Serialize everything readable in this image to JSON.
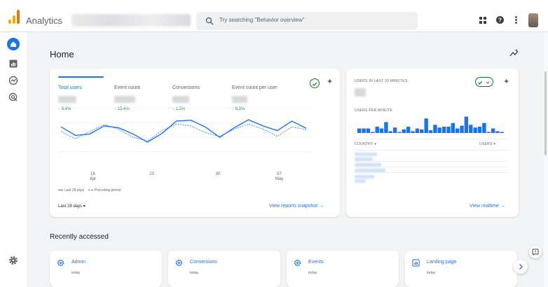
{
  "app": {
    "title": "Analytics"
  },
  "search": {
    "placeholder": "Try searching \"Behavior overview\""
  },
  "page": {
    "title": "Home"
  },
  "metrics": [
    {
      "label": "Total users",
      "delta": "↑ 9.4%",
      "active": true
    },
    {
      "label": "Event count",
      "delta": "↑ 15.4%",
      "active": false
    },
    {
      "label": "Conversions",
      "delta": "↑ 1.5%",
      "active": false
    },
    {
      "label": "Event count per user",
      "delta": "↑ 6.3%",
      "active": false
    }
  ],
  "chart": {
    "x_ticks": [
      {
        "day": "16",
        "month": "Apr"
      },
      {
        "day": "23",
        "month": ""
      },
      {
        "day": "30",
        "month": ""
      },
      {
        "day": "07",
        "month": "May"
      }
    ],
    "legend_current": "Last 28 days",
    "legend_previous": "Preceding period",
    "current": [
      0.6,
      0.42,
      0.45,
      0.62,
      0.58,
      0.45,
      0.28,
      0.46,
      0.72,
      0.74,
      0.6,
      0.38,
      0.58,
      0.75,
      0.62,
      0.52,
      0.72,
      0.57
    ],
    "previous": [
      0.5,
      0.35,
      0.5,
      0.65,
      0.55,
      0.38,
      0.3,
      0.52,
      0.66,
      0.62,
      0.48,
      0.4,
      0.55,
      0.66,
      0.55,
      0.4,
      0.6,
      0.54
    ]
  },
  "main_card": {
    "range": "Last 28 days",
    "view_link": "View reports snapshot"
  },
  "realtime": {
    "title": "USERS IN LAST 30 MINUTES",
    "per_minute": "USERS PER MINUTE",
    "country_col": "COUNTRY",
    "users_col": "USERS",
    "view_link": "View realtime",
    "bars": [
      0.25,
      0.25,
      0.25,
      0.05,
      0.35,
      0.25,
      0.6,
      0.1,
      0.3,
      0.05,
      0.2,
      0.35,
      0.1,
      0.25,
      0.2,
      0.8,
      0.15,
      0.45,
      0.3,
      0.35,
      0.35,
      0.55,
      0.25,
      0.4,
      0.9,
      0.45,
      0.3,
      0.35,
      0.55,
      0.05,
      0.25,
      0.1,
      0.05
    ]
  },
  "recent": {
    "title": "Recently accessed",
    "items": [
      {
        "label": "Admin",
        "when": "today",
        "icon": "gear-icon"
      },
      {
        "label": "Conversions",
        "when": "today",
        "icon": "gear-icon"
      },
      {
        "label": "Events",
        "when": "today",
        "icon": "gear-icon"
      },
      {
        "label": "Landing page",
        "when": "today",
        "icon": "report-icon"
      }
    ]
  },
  "colors": {
    "accent": "#1a73e8",
    "positive": "#137333",
    "logo_orange": "#f9ab00",
    "logo_dark": "#e37400"
  }
}
